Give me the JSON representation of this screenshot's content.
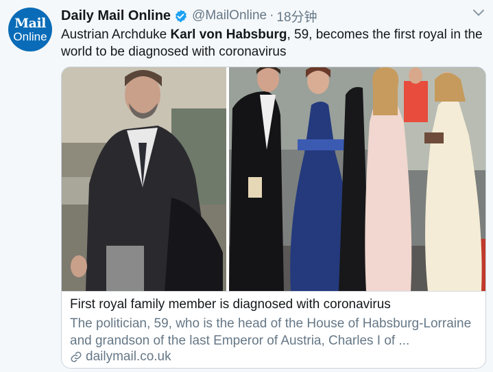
{
  "account": {
    "name": "Daily Mail Online",
    "handle": "@MailOnline",
    "separator": "·",
    "time": "18分钟",
    "avatar_line1": "Mail",
    "avatar_line2": "Online"
  },
  "tweet": {
    "text_before": "Austrian Archduke ",
    "text_bold": "Karl von Habsburg",
    "text_after": ", 59, becomes the first royal in the world to be diagnosed with coronavirus"
  },
  "card": {
    "title": "First royal family member is diagnosed with coronavirus",
    "description": "The politician, 59, who is the head of the House of Habsburg-Lorraine and grandson of the last Emperor of Austria, Charles I of ...",
    "domain": "dailymail.co.uk"
  },
  "icons": {
    "verified": "verified-badge-icon",
    "menu": "chevron-down-icon",
    "link": "link-icon"
  },
  "colors": {
    "brand_blue": "#0a6cb8",
    "verified_blue": "#1da1f2",
    "secondary_text": "#657786",
    "background": "#f5f8fa"
  }
}
